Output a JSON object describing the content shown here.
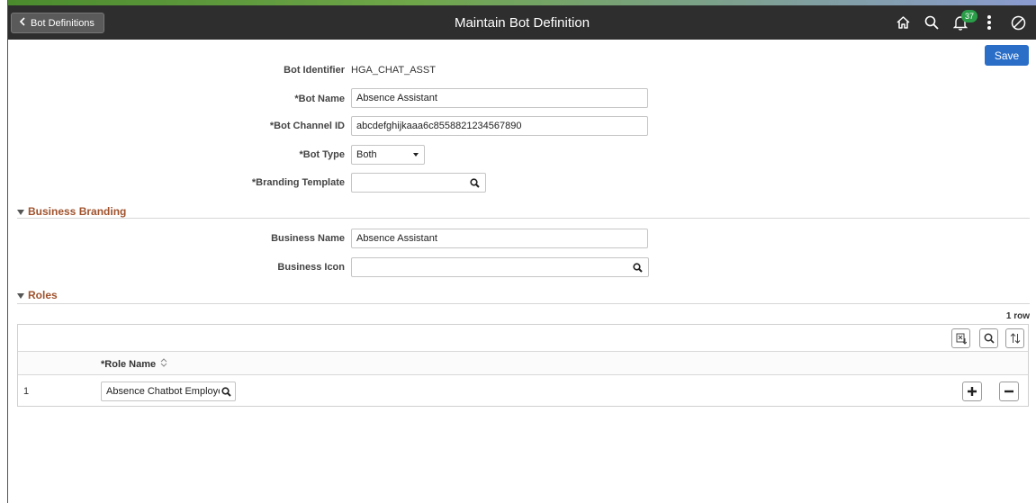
{
  "header": {
    "back_label": "Bot Definitions",
    "title": "Maintain Bot Definition",
    "notification_count": "37",
    "icons": [
      "home-icon",
      "search-icon",
      "notifications-icon",
      "actions-menu-icon",
      "navbar-icon"
    ]
  },
  "toolbar": {
    "save_label": "Save"
  },
  "form": {
    "bot_identifier_label": "Bot Identifier",
    "bot_identifier_value": "HGA_CHAT_ASST",
    "bot_name_label": "*Bot Name",
    "bot_name_value": "Absence Assistant",
    "bot_channel_label": "*Bot Channel ID",
    "bot_channel_value": "abcdefghijkaaa6c8558821234567890",
    "bot_type_label": "*Bot Type",
    "bot_type_value": "Both",
    "branding_template_label": "*Branding Template",
    "branding_template_value": ""
  },
  "business_branding": {
    "section_title": "Business Branding",
    "business_name_label": "Business Name",
    "business_name_value": "Absence Assistant",
    "business_icon_label": "Business Icon",
    "business_icon_value": ""
  },
  "roles": {
    "section_title": "Roles",
    "row_count": "1 row",
    "column_header": "*Role Name",
    "rows": [
      {
        "num": "1",
        "role_name": "Absence Chatbot Employe"
      }
    ]
  },
  "colors": {
    "banner": "#2e2e2e",
    "save_button": "#2a6ec8",
    "section_title": "#a0522d",
    "badge": "#2a9d48"
  }
}
